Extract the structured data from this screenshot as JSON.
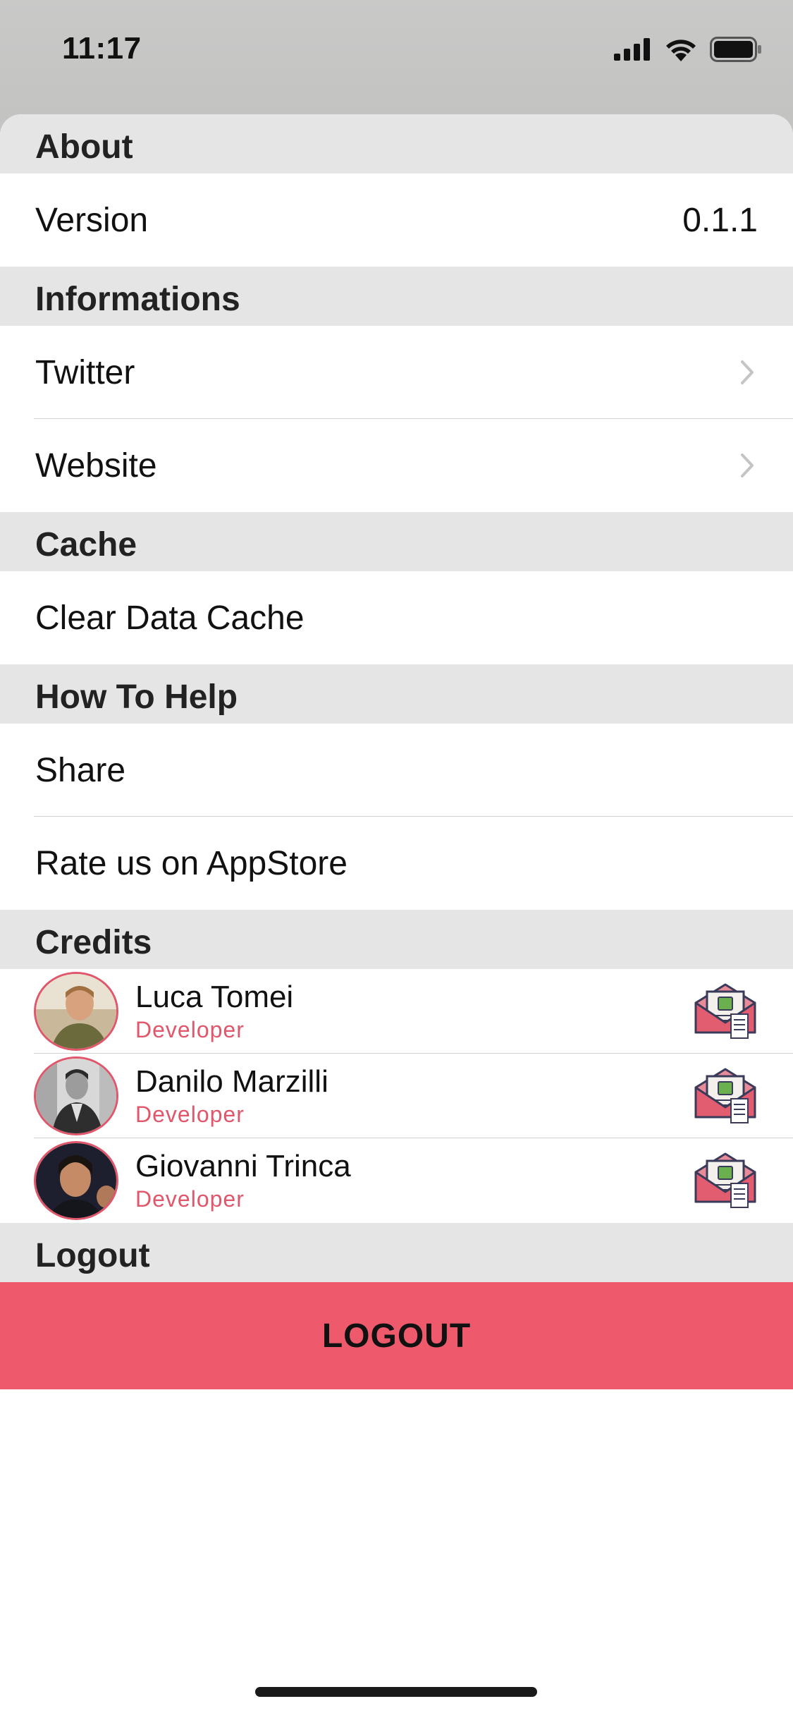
{
  "status_bar": {
    "time": "11:17"
  },
  "sections": {
    "about": {
      "header": "About",
      "version_label": "Version",
      "version_value": "0.1.1"
    },
    "informations": {
      "header": "Informations",
      "twitter_label": "Twitter",
      "website_label": "Website"
    },
    "cache": {
      "header": "Cache",
      "clear_label": "Clear Data Cache"
    },
    "help": {
      "header": "How To Help",
      "share_label": "Share",
      "rate_label": "Rate us on AppStore"
    },
    "credits": {
      "header": "Credits",
      "people": [
        {
          "name": "Luca Tomei",
          "role": "Developer"
        },
        {
          "name": "Danilo Marzilli",
          "role": "Developer"
        },
        {
          "name": "Giovanni Trinca",
          "role": "Developer"
        }
      ]
    },
    "logout": {
      "header": "Logout",
      "button_label": "LOGOUT"
    }
  },
  "icons": {
    "chevron": "chevron-right-icon",
    "mail": "mail-icon",
    "signal": "signal-icon",
    "wifi": "wifi-icon",
    "battery": "battery-icon"
  },
  "colors": {
    "accent": "#ee5a6c",
    "role_text": "#e0566a",
    "section_bg": "#e5e5e5"
  }
}
